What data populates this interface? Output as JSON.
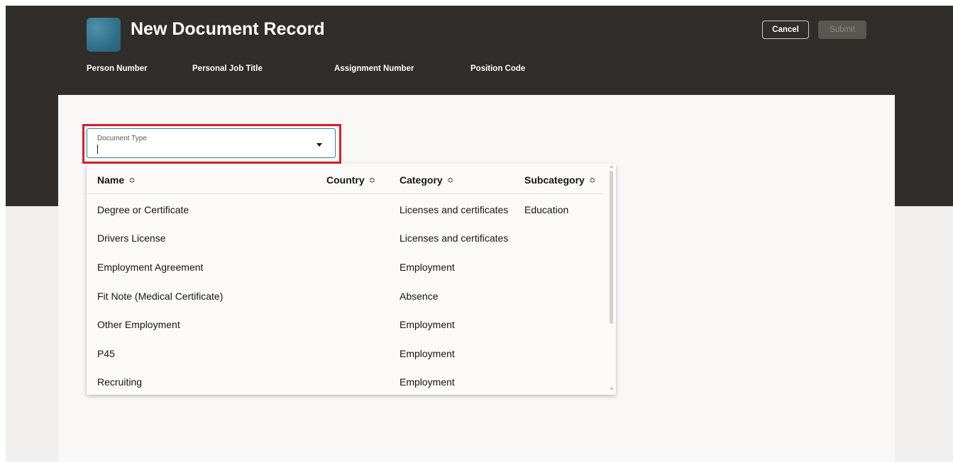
{
  "header": {
    "title": "New Document Record",
    "attributes": [
      "Person Number",
      "Personal Job Title",
      "Assignment Number",
      "Position Code"
    ],
    "cancel_label": "Cancel",
    "submit_label": "Submit"
  },
  "form": {
    "document_type_label": "Document Type",
    "document_type_value": ""
  },
  "dropdown": {
    "columns": [
      "Name",
      "Country",
      "Category",
      "Subcategory"
    ],
    "rows": [
      {
        "name": "Degree or Certificate",
        "country": "",
        "category": "Licenses and certificates",
        "subcategory": "Education"
      },
      {
        "name": "Drivers License",
        "country": "",
        "category": "Licenses and certificates",
        "subcategory": ""
      },
      {
        "name": "Employment Agreement",
        "country": "",
        "category": "Employment",
        "subcategory": ""
      },
      {
        "name": "Fit Note (Medical Certificate)",
        "country": "",
        "category": "Absence",
        "subcategory": ""
      },
      {
        "name": "Other Employment",
        "country": "",
        "category": "Employment",
        "subcategory": ""
      },
      {
        "name": "P45",
        "country": "",
        "category": "Employment",
        "subcategory": ""
      },
      {
        "name": "Recruiting",
        "country": "",
        "category": "Employment",
        "subcategory": ""
      }
    ]
  },
  "icons": {
    "sort": "sort-icon",
    "dropdown": "caret-down-icon"
  },
  "colors": {
    "header_bg": "#312d2a",
    "highlight": "#d6202d",
    "focus": "#2e88a6",
    "link": "#1e47c8"
  }
}
